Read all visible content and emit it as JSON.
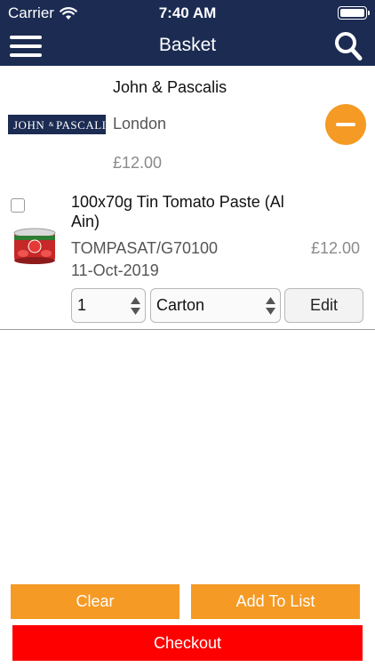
{
  "status_bar": {
    "carrier": "Carrier",
    "time": "7:40 AM",
    "wifi_icon": "wifi-icon",
    "battery_icon": "battery-icon"
  },
  "nav": {
    "title": "Basket",
    "menu_icon": "hamburger-menu-icon",
    "search_icon": "search-icon",
    "background_color": "#1b2b52"
  },
  "supplier": {
    "name": "John & Pascalis",
    "logo_text": "JOHN PASCALIS",
    "city": "London",
    "total": "£12.00",
    "remove_icon": "minus-circle-icon",
    "remove_color": "#f59a24"
  },
  "item": {
    "name": "100x70g Tin Tomato Paste (Al Ain)",
    "code": "TOMPASAT/G70100",
    "date": "11-Oct-2019",
    "price": "£12.00",
    "checked": false,
    "image_icon": "tomato-paste-tin-image",
    "quantity": "1",
    "unit": "Carton",
    "edit_label": "Edit"
  },
  "actions": {
    "clear_label": "Clear",
    "add_to_list_label": "Add To List",
    "checkout_label": "Checkout",
    "accent_color": "#f59a24",
    "checkout_color": "#ff0000"
  }
}
